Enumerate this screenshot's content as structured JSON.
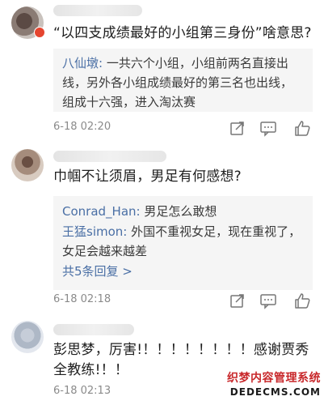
{
  "comments": [
    {
      "text": "“以四支成绩最好的小组第三身份”啥意思?",
      "replies": [
        {
          "author": "八仙墩:",
          "text": " 一共六个小组，小组前两名直接出线，另外各小组成绩最好的第三名也出线，组成十六强，进入淘汰赛"
        }
      ],
      "time": "6-18 02:20"
    },
    {
      "text": "巾帼不让须眉，男足有何感想?",
      "replies": [
        {
          "author": "Conrad_Han:",
          "text": " 男足怎么敢想"
        },
        {
          "author": "王猛simon:",
          "text": " 外国不重视女足，现在重视了，女足会越来越差"
        }
      ],
      "more": "共5条回复 >",
      "time": "6-18 02:18"
    },
    {
      "text": "彭思梦，厉害!！！！！！！！！感谢贾秀全教练!！！",
      "time": "6-18 02:13"
    }
  ],
  "icons": [
    "share-icon",
    "comment-icon",
    "like-icon"
  ],
  "watermark": {
    "top": "织梦内容管理系统",
    "bottom": "DEDECMS.COM"
  },
  "colors": {
    "link": "#4a6fa5",
    "badge": "#e5452f",
    "watermark": "#c8282b"
  }
}
